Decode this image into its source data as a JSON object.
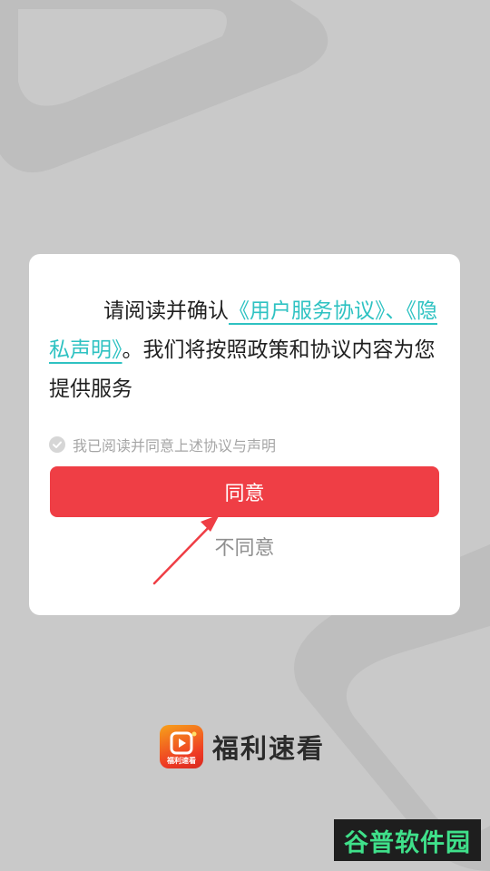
{
  "dialog": {
    "message_prefix": "请阅读并确认",
    "link_user_agreement": "《用户服务协议》、",
    "link_privacy": "《隐私声明》",
    "message_suffix": "。我们将按照政策和协议内容为您提供服务",
    "checkbox_label": "我已阅读并同意上述协议与声明",
    "agree_label": "同意",
    "disagree_label": "不同意"
  },
  "brand": {
    "app_icon_text": "福利速看",
    "app_name": "福利速看"
  },
  "watermark": {
    "text": "谷普软件园"
  },
  "colors": {
    "accent_red": "#ef3e45",
    "link_teal": "#2ec2c2",
    "background": "#c9c9c9"
  }
}
